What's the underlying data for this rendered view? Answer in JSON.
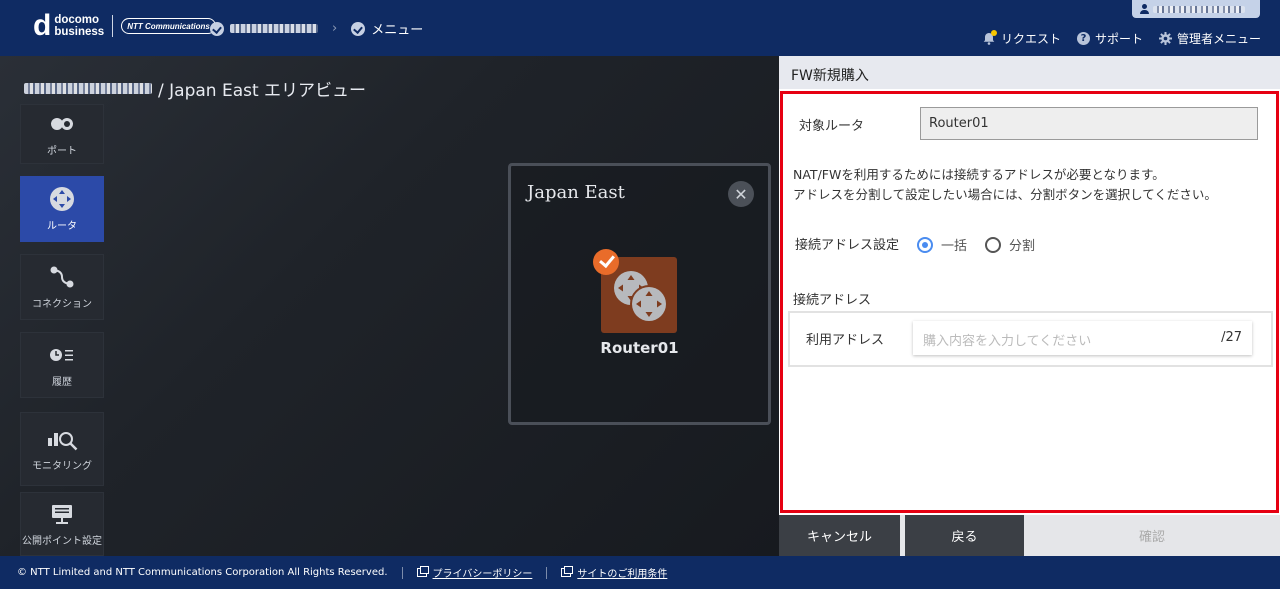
{
  "header": {
    "logo_mark": "d",
    "logo_line1": "docomo",
    "logo_line2": "business",
    "ntt_badge": "NTT Communications",
    "breadcrumb_menu": "メニュー",
    "nav": {
      "request": "リクエスト",
      "support": "サポート",
      "admin_menu": "管理者メニュー"
    }
  },
  "area": {
    "title_suffix": "/ Japan East エリアビュー",
    "sidebar": [
      {
        "label": "ポート",
        "icon": "port-icon"
      },
      {
        "label": "ルータ",
        "icon": "router-icon",
        "active": true
      },
      {
        "label": "コネクション",
        "icon": "connection-icon"
      },
      {
        "label": "履歴",
        "icon": "history-icon"
      },
      {
        "label": "モニタリング",
        "icon": "monitoring-icon"
      },
      {
        "label": "公開ポイント設定",
        "icon": "public-point-icon"
      }
    ],
    "region": {
      "title": "Japan East",
      "router_name": "Router01"
    }
  },
  "panel": {
    "title": "FW新規購入",
    "target_router_label": "対象ルータ",
    "target_router_value": "Router01",
    "notice_line1": "NAT/FWを利用するためには接続するアドレスが必要となります。",
    "notice_line2": "アドレスを分割して設定したい場合には、分割ボタンを選択してください。",
    "address_setting_label": "接続アドレス設定",
    "radio_bulk": "一括",
    "radio_split": "分割",
    "selected_mode": "一括",
    "address_section_label": "接続アドレス",
    "use_address_label": "利用アドレス",
    "use_address_placeholder": "購入内容を入力してください",
    "use_address_value": "",
    "prefix_suffix": "/27",
    "buttons": {
      "cancel": "キャンセル",
      "back": "戻る",
      "confirm": "確認"
    }
  },
  "footer": {
    "copyright": "© NTT Limited and NTT Communications Corporation All Rights Reserved.",
    "privacy": "プライバシーポリシー",
    "terms": "サイトのご利用条件"
  },
  "colors": {
    "header_bg": "#0f2b63",
    "active_sidebar": "#2c4aa8",
    "router_tile": "#7e3c1f",
    "check_badge": "#e96c2a",
    "highlight_frame": "#e60012",
    "radio_selected": "#4a8cf0"
  }
}
